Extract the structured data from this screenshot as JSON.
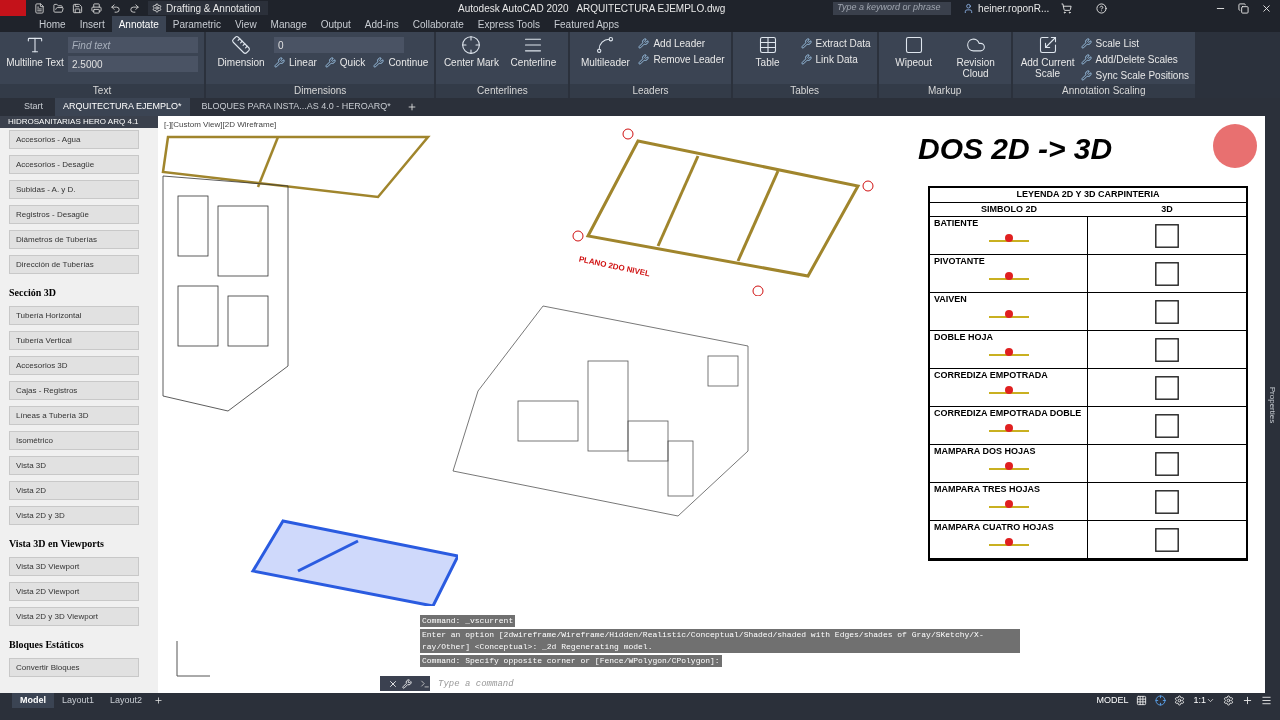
{
  "title_bar": {
    "workspace": "Drafting & Annotation",
    "title": "Autodesk AutoCAD 2020   ARQUITECTURA EJEMPLO.dwg",
    "search": {
      "placeholder": "Type a keyword or phrase"
    },
    "user": "heiner.roponR..."
  },
  "ribbon_tabs": [
    {
      "label": "Home",
      "selected": false
    },
    {
      "label": "Insert",
      "selected": false
    },
    {
      "label": "Annotate",
      "selected": true
    },
    {
      "label": "Parametric",
      "selected": false
    },
    {
      "label": "View",
      "selected": false
    },
    {
      "label": "Manage",
      "selected": false
    },
    {
      "label": "Output",
      "selected": false
    },
    {
      "label": "Add-ins",
      "selected": false
    },
    {
      "label": "Collaborate",
      "selected": false
    },
    {
      "label": "Express Tools",
      "selected": false
    },
    {
      "label": "Featured Apps",
      "selected": false
    }
  ],
  "ribbon_panels": [
    {
      "title": "Text",
      "large": [
        {
          "label": "Multiline Text"
        }
      ],
      "fields": [
        {
          "placeholder": "Find text"
        },
        {
          "value": "2.5000"
        }
      ]
    },
    {
      "title": "Dimensions",
      "large": [
        {
          "label": "Dimension"
        }
      ],
      "fields": [
        {
          "value": "0"
        }
      ],
      "small": [
        {
          "label": "Linear"
        },
        {
          "label": "Quick"
        },
        {
          "label": "Continue"
        }
      ]
    },
    {
      "title": "Centerlines",
      "large": [
        {
          "label": "Center Mark"
        },
        {
          "label": "Centerline"
        }
      ]
    },
    {
      "title": "Leaders",
      "large": [
        {
          "label": "Multileader"
        }
      ],
      "small": [
        {
          "label": "Add Leader"
        },
        {
          "label": "Remove Leader"
        }
      ]
    },
    {
      "title": "Tables",
      "large": [
        {
          "label": "Table"
        }
      ],
      "small": [
        {
          "label": "Extract Data"
        },
        {
          "label": "Link Data"
        }
      ]
    },
    {
      "title": "Markup",
      "large": [
        {
          "label": "Wipeout"
        },
        {
          "label": "Revision Cloud"
        }
      ]
    },
    {
      "title": "Annotation Scaling",
      "large": [
        {
          "label": "Add Current Scale"
        }
      ],
      "small": [
        {
          "label": "Scale List"
        },
        {
          "label": "Add/Delete Scales"
        },
        {
          "label": "Sync Scale Positions"
        }
      ]
    }
  ],
  "file_tabs": [
    {
      "label": "Start",
      "selected": false
    },
    {
      "label": "ARQUITECTURA EJEMPLO*",
      "selected": true
    },
    {
      "label": "BLOQUES PARA INSTA...AS 4.0 - HEROARQ*",
      "selected": false
    }
  ],
  "palette": {
    "title": "HIDROSANITARIAS HERO ARQ 4.1",
    "sections": [
      {
        "items": [
          "Accesorios - Agua",
          "Accesorios - Desagüe",
          "Subidas - A. y D.",
          "Registros - Desagüe",
          "Diámetros de Tuberías",
          "Dirección de Tuberías"
        ]
      },
      {
        "heading": "Sección 3D",
        "items": [
          "Tubería Horizontal",
          "Tubería Vertical",
          "Accesorios 3D",
          "Cajas - Registros",
          "Líneas a Tubería 3D",
          "Isométrico",
          "Vista 3D",
          "Vista 2D",
          "Vista 2D y 3D"
        ]
      },
      {
        "heading": "Vista 3D en Viewports",
        "items": [
          "Vista 3D Viewport",
          "Vista 2D Viewport",
          "Vista 2D y 3D Viewport"
        ]
      },
      {
        "heading": "Bloques Estáticos",
        "items": [
          "Convertir Bloques"
        ]
      }
    ]
  },
  "viewport": {
    "label": "[-][Custom View][2D Wireframe]",
    "heading": "DOS 2D -> 3D",
    "sheet_label": "PLANO 2DO NIVEL",
    "legend": {
      "title": "LEYENDA 2D Y 3D CARPINTERIA",
      "columns": [
        "SIMBOLO 2D",
        "3D"
      ],
      "rows": [
        "BATIENTE",
        "PIVOTANTE",
        "VAIVEN",
        "DOBLE HOJA",
        "CORREDIZA EMPOTRADA",
        "CORREDIZA EMPOTRADA DOBLE",
        "MAMPARA DOS HOJAS",
        "MAMPARA TRES HOJAS",
        "MAMPARA CUATRO HOJAS"
      ]
    }
  },
  "command_history": [
    "Command: _vscurrent",
    "Enter an option [2dwireframe/Wireframe/Hidden/Realistic/Conceptual/Shaded/shaded with Edges/shades of Gray/SKetchy/X-ray/Other] <Conceptual>: _2d Regenerating model.",
    "Command: Specify opposite corner or [Fence/WPolygon/CPolygon]:"
  ],
  "command_line": {
    "placeholder": "Type a command"
  },
  "side_strip": "Properties",
  "layout_tabs": [
    {
      "label": "Model",
      "selected": true
    },
    {
      "label": "Layout1",
      "selected": false
    },
    {
      "label": "Layout2",
      "selected": false
    }
  ],
  "status_bar": {
    "space": "MODEL",
    "scale": "1:1"
  }
}
